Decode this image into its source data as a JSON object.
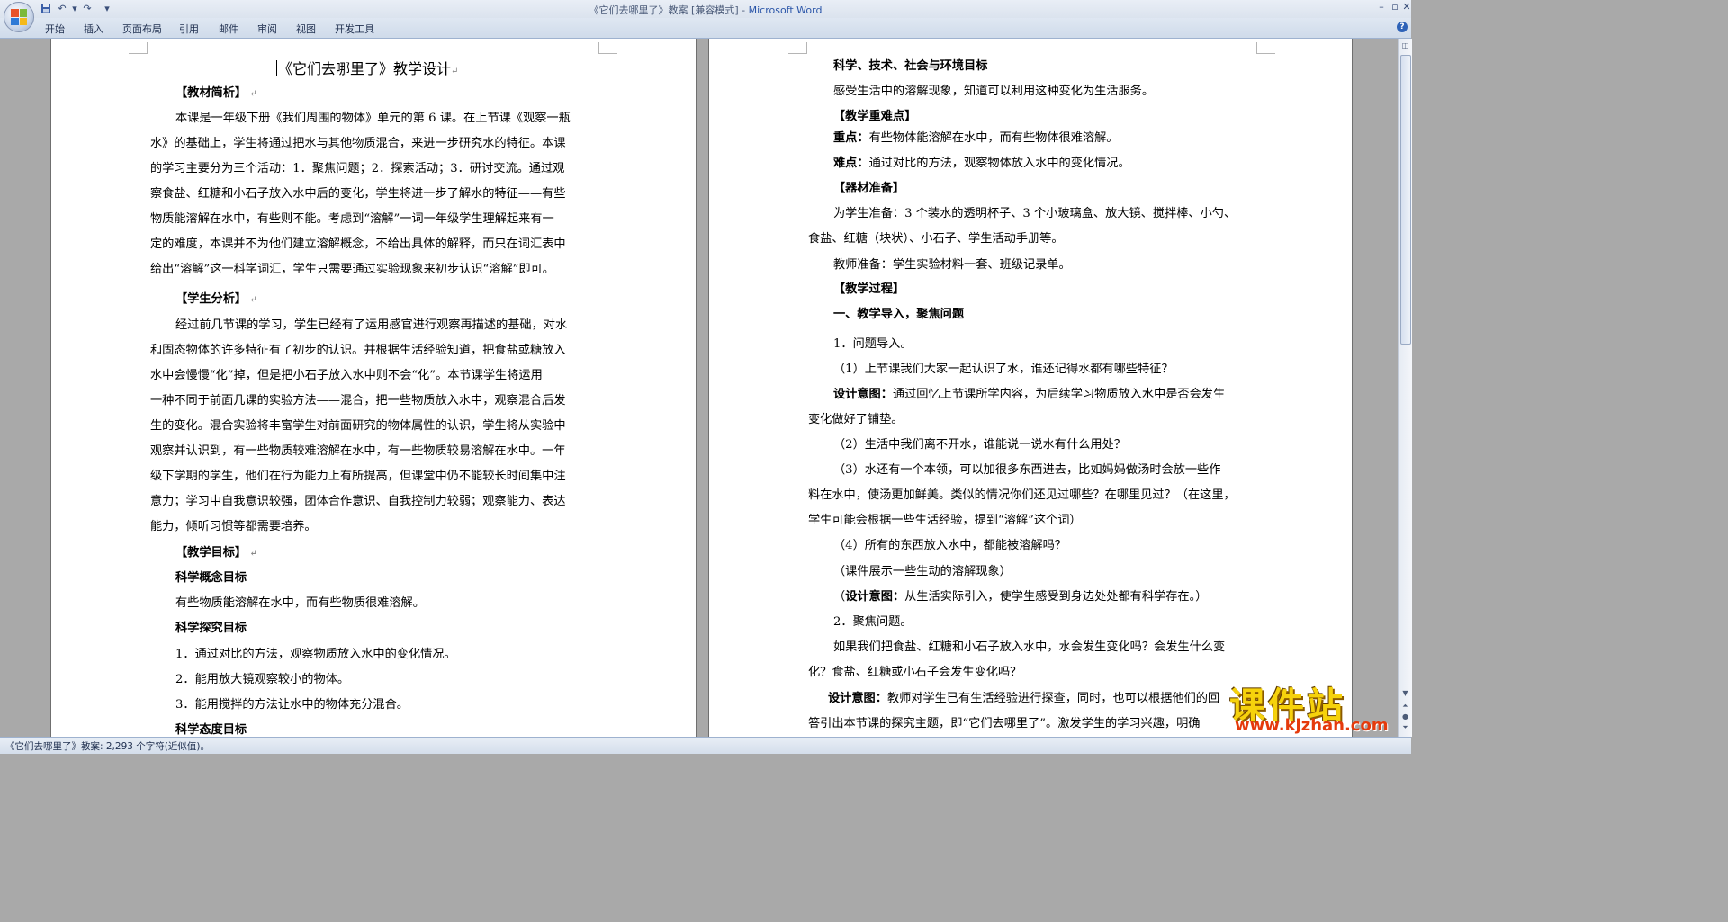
{
  "window": {
    "doc_name": "《它们去哪里了》教案 [兼容模式]",
    "separator": " - ",
    "app_name": "Microsoft Word"
  },
  "quick_access": {
    "save_icon": "save-icon",
    "undo_icon": "undo-icon",
    "redo_icon": "redo-icon",
    "customize": "▾"
  },
  "ribbon": {
    "tabs": [
      "开始",
      "插入",
      "页面布局",
      "引用",
      "邮件",
      "审阅",
      "视图",
      "开发工具"
    ],
    "help": "?"
  },
  "left_page": {
    "title": "《它们去哪里了》教学设计",
    "lines": [
      "【教材简析】",
      "本课是一年级下册《我们周围的物体》单元的第 6 课。在上节课《观察一瓶",
      "水》的基础上，学生将通过把水与其他物质混合，来进一步研究水的特征。本课",
      "的学习主要分为三个活动：1．聚焦问题；2．探索活动；3．研讨交流。通过观",
      "察食盐、红糖和小石子放入水中后的变化，学生将进一步了解水的特征——有些",
      "物质能溶解在水中，有些则不能。考虑到“溶解”一词一年级学生理解起来有一",
      "定的难度，本课并不为他们建立溶解概念，不给出具体的解释，而只在词汇表中",
      "给出“溶解”这一科学词汇，学生只需要通过实验现象来初步认识“溶解”即可。",
      "【学生分析】",
      "经过前几节课的学习，学生已经有了运用感官进行观察再描述的基础，对水",
      "和固态物体的许多特征有了初步的认识。并根据生活经验知道，把食盐或糖放入",
      "水中会慢慢“化”掉，但是把小石子放入水中则不会“化”。本节课学生将运用",
      "一种不同于前面几课的实验方法——混合，把一些物质放入水中，观察混合后发",
      "生的变化。混合实验将丰富学生对前面研究的物体属性的认识，学生将从实验中",
      "观察并认识到，有一些物质较难溶解在水中，有一些物质较易溶解在水中。一年",
      "级下学期的学生，他们在行为能力上有所提高，但课堂中仍不能较长时间集中注",
      "意力；学习中自我意识较强，团体合作意识、自我控制力较弱；观察能力、表达",
      "能力，倾听习惯等都需要培养。",
      "【教学目标】",
      "科学概念目标",
      "有些物质能溶解在水中，而有些物质很难溶解。",
      "科学探究目标",
      "1．通过对比的方法，观察物质放入水中的变化情况。",
      "2．能用放大镜观察较小的物体。",
      "3．能用搅拌的方法让水中的物体充分混合。",
      "科学态度目标"
    ]
  },
  "right_page": {
    "lines": [
      "科学、技术、社会与环境目标",
      "感受生活中的溶解现象，知道可以利用这种变化为生活服务。",
      "【教学重难点】",
      "重点：",
      "有些物体能溶解在水中，而有些物体很难溶解。",
      "难点：",
      "通过对比的方法，观察物体放入水中的变化情况。",
      "【器材准备】",
      "为学生准备：3 个装水的透明杯子、3 个小玻璃盒、放大镜、搅拌棒、小勺、",
      "食盐、红糖（块状）、小石子、学生活动手册等。",
      "教师准备：学生实验材料一套、班级记录单。",
      "【教学过程】",
      "一、教学导入，聚焦问题",
      "1．问题导入。",
      "（1）上节课我们大家一起认识了水，谁还记得水都有哪些特征？",
      "设计意图：",
      "通过回忆上节课所学内容，为后续学习物质放入水中是否会发生",
      "变化做好了铺垫。",
      "（2）生活中我们离不开水，谁能说一说水有什么用处？",
      "（3）水还有一个本领，可以加很多东西进去，比如妈妈做汤时会放一些作",
      "料在水中，使汤更加鲜美。类似的情况你们还见过哪些？在哪里见过？（在这里，",
      "学生可能会根据一些生活经验，提到“溶解”这个词）",
      "（4）所有的东西放入水中，都能被溶解吗？",
      "（课件展示一些生动的溶解现象）",
      "（",
      "设计意图：",
      "从生活实际引入，使学生感受到身边处处都有科学存在。）",
      "2．聚焦问题。",
      "如果我们把食盐、红糖和小石子放入水中，水会发生变化吗？会发生什么变",
      "化？食盐、红糖或小石子会发生变化吗？",
      "设计意图：",
      "教师对学生已有生活经验进行探查，同时，也可以根据他们的回",
      "答引出本节课的探究主题，即“它们去哪里了”。激发学生的学习兴趣，明确"
    ]
  },
  "status": {
    "text": "《它们去哪里了》教案: 2,293 个字符(近似值)。"
  },
  "watermark": {
    "big": "课件站",
    "url": "www.kjzhan.com"
  }
}
